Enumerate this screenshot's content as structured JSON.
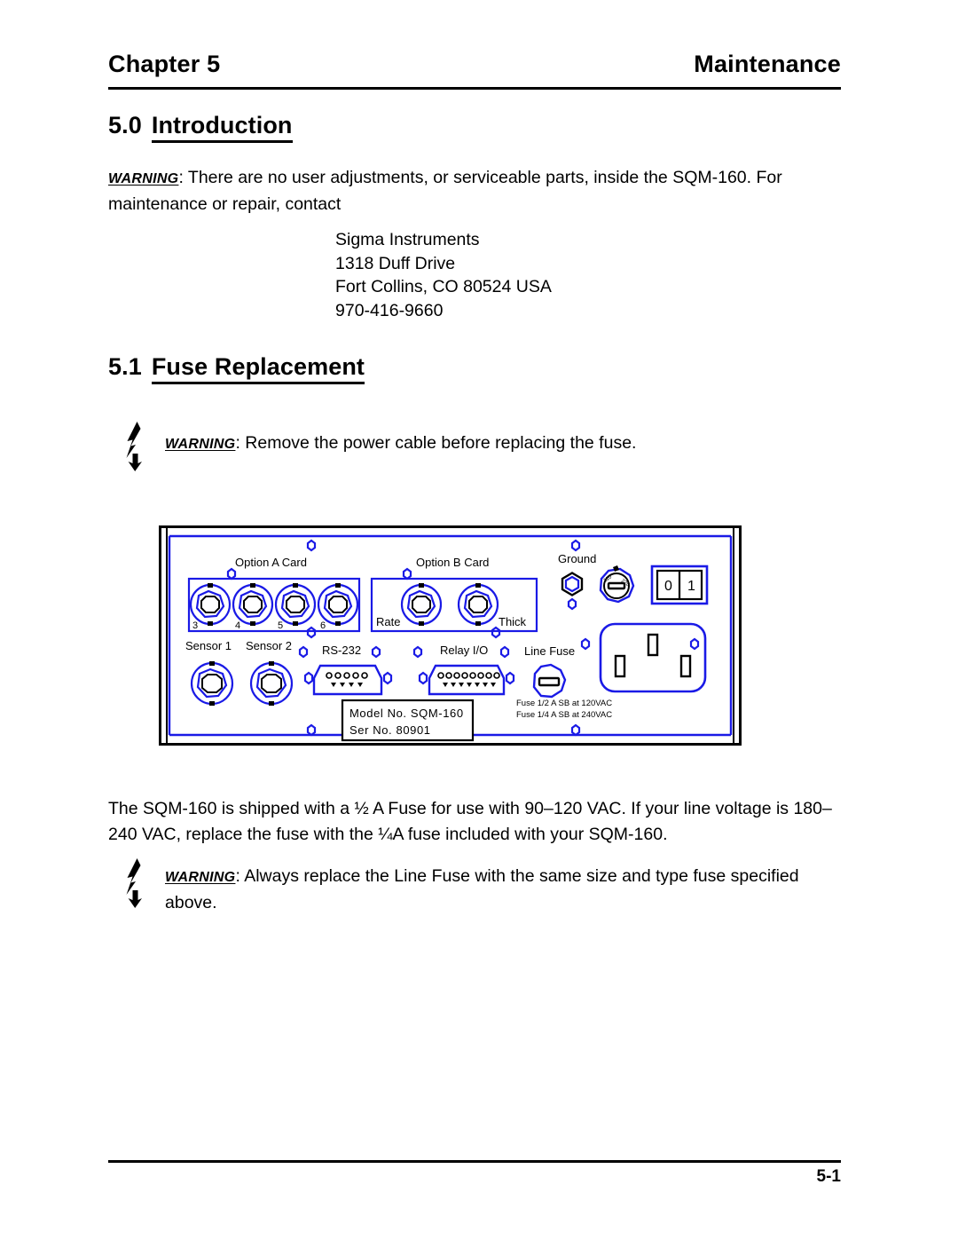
{
  "header": {
    "chapter": "Chapter 5",
    "topic": "Maintenance"
  },
  "sections": [
    {
      "number": "5.0",
      "title": "Introduction"
    },
    {
      "number": "5.1",
      "title": "Fuse Replacement"
    }
  ],
  "intro": {
    "warning_word": "WARNING",
    "text": ":  There are no user adjustments, or serviceable parts, inside the SQM-160. For maintenance or repair, contact"
  },
  "address": {
    "line1": "Sigma Instruments",
    "line2": "1318 Duff Drive",
    "line3": "Fort Collins, CO  80524  USA",
    "line4": "970-416-9660"
  },
  "warning1": {
    "icon": "lightning-bolt-icon",
    "warning_word": "WARNING",
    "text": ":  Remove the power cable before replacing the fuse."
  },
  "warning2": {
    "icon": "lightning-bolt-icon",
    "warning_word": "WARNING",
    "text": ": Always replace the Line Fuse with the same size and type fuse specified above."
  },
  "body_paragraph": "The SQM-160 is shipped with a ½ A Fuse for use with 90–120 VAC.  If your line voltage is 180–240 VAC, replace the fuse with the ¼A fuse included with your SQM-160.",
  "diagram": {
    "name": "sqm-160-rear-panel",
    "accent_color": "#1a1ae6",
    "outline_color": "#000000",
    "labels": {
      "option_a_card": "Option A Card",
      "option_b_card": "Option B Card",
      "ground": "Ground",
      "sensor_1": "Sensor 1",
      "sensor_2": "Sensor 2",
      "rs_232": "RS-232",
      "relay_io": "Relay I/O",
      "line_fuse": "Line Fuse",
      "rate": "Rate",
      "thick": "Thick",
      "power_off": "0",
      "power_on": "1"
    },
    "option_a_connector_numbers": [
      "3",
      "4",
      "5",
      "6"
    ],
    "nameplate": {
      "model_line": "Model No.  SQM-160",
      "serial_line": "Ser No.  80901"
    },
    "fuse_ratings": [
      "Fuse 1/2 A SB at 120VAC",
      "Fuse 1/4 A SB at 240VAC"
    ]
  },
  "footer": {
    "page_number": "5-1"
  }
}
